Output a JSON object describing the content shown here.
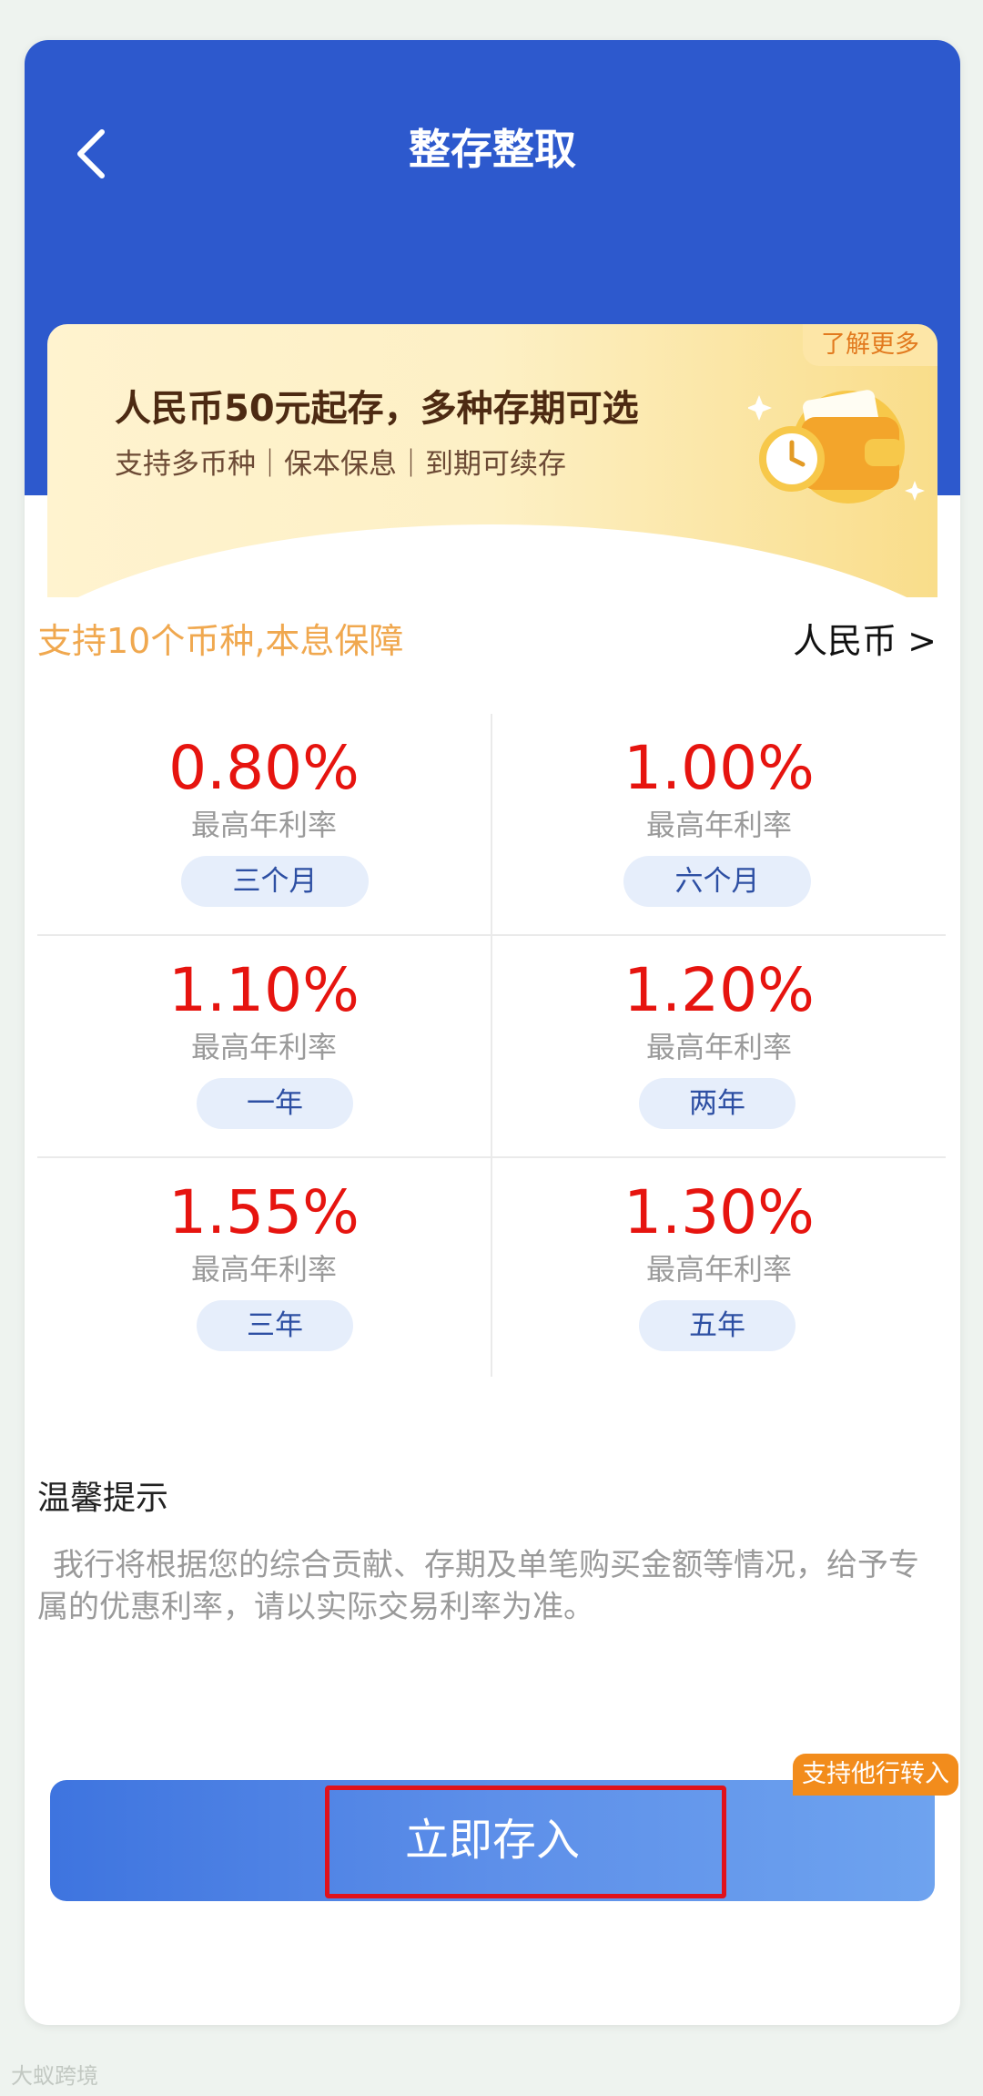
{
  "header": {
    "title": "整存整取",
    "back_icon": "chevron-left-icon"
  },
  "banner": {
    "tag": "了解更多",
    "title": "人民币50元起存，多种存期可选",
    "subtitle": "支持多币种｜保本保息｜到期可续存",
    "art": "wallet-clock-icon"
  },
  "section": {
    "promo": "支持10个币种,本息保障",
    "currency": "人民币 >"
  },
  "rates": [
    {
      "rate": "0.80%",
      "label": "最高年利率",
      "term": "三个月"
    },
    {
      "rate": "1.00%",
      "label": "最高年利率",
      "term": "六个月"
    },
    {
      "rate": "1.10%",
      "label": "最高年利率",
      "term": "一年"
    },
    {
      "rate": "1.20%",
      "label": "最高年利率",
      "term": "两年"
    },
    {
      "rate": "1.55%",
      "label": "最高年利率",
      "term": "三年"
    },
    {
      "rate": "1.30%",
      "label": "最高年利率",
      "term": "五年"
    }
  ],
  "tips": {
    "title": "温馨提示",
    "body": "我行将根据您的综合贡献、存期及单笔购买金额等情况，给予专属的优惠利率，请以实际交易利率为准。"
  },
  "cta": {
    "label": "立即存入",
    "badge": "支持他行转入"
  },
  "watermark": "大蚁跨境",
  "colors": {
    "header_blue": "#2d59cd",
    "rate_red": "#e6140f",
    "promo_orange": "#f0a84f",
    "cta_blue": "#3e74df",
    "badge_orange": "#f28c1c"
  }
}
